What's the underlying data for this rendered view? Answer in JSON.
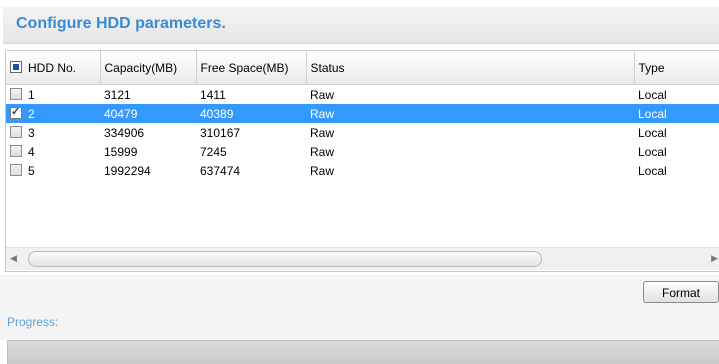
{
  "header": {
    "title": "Configure HDD parameters."
  },
  "table": {
    "columns": [
      "HDD No.",
      "Capacity(MB)",
      "Free Space(MB)",
      "Status",
      "Type"
    ],
    "rows": [
      {
        "no": "1",
        "capacity": "3121",
        "free": "1411",
        "status": "Raw",
        "type": "Local",
        "checked": false,
        "selected": false
      },
      {
        "no": "2",
        "capacity": "40479",
        "free": "40389",
        "status": "Raw",
        "type": "Local",
        "checked": true,
        "selected": true
      },
      {
        "no": "3",
        "capacity": "334906",
        "free": "310167",
        "status": "Raw",
        "type": "Local",
        "checked": false,
        "selected": false
      },
      {
        "no": "4",
        "capacity": "15999",
        "free": "7245",
        "status": "Raw",
        "type": "Local",
        "checked": false,
        "selected": false
      },
      {
        "no": "5",
        "capacity": "1992294",
        "free": "637474",
        "status": "Raw",
        "type": "Local",
        "checked": false,
        "selected": false
      }
    ]
  },
  "actions": {
    "format_label": "Format"
  },
  "progress": {
    "label": "Progress:",
    "value": 0
  },
  "colors": {
    "accent": "#3c8ad2",
    "selection": "#3399ff",
    "progress_label": "#5aa3e0"
  }
}
